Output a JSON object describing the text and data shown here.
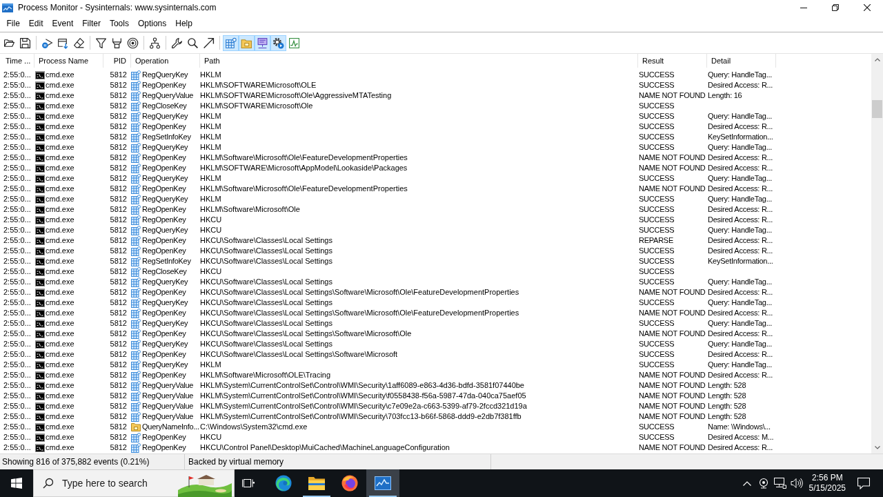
{
  "window": {
    "title": "Process Monitor - Sysinternals: www.sysinternals.com"
  },
  "menu": [
    "File",
    "Edit",
    "Event",
    "Filter",
    "Tools",
    "Options",
    "Help"
  ],
  "toolbar": {
    "event_class_toggles": [
      {
        "kind": "registry",
        "selected": true
      },
      {
        "kind": "file-system",
        "selected": true
      },
      {
        "kind": "network",
        "selected": true
      },
      {
        "kind": "process",
        "selected": true
      },
      {
        "kind": "profiling",
        "selected": false
      }
    ]
  },
  "table": {
    "columns": [
      "Time ...",
      "Process Name",
      "PID",
      "Operation",
      "Path",
      "Result",
      "Detail"
    ],
    "rows": [
      {
        "time": "2:55:0...",
        "process": "cmd.exe",
        "pid": "5812",
        "kind": "registry",
        "operation": "RegQueryKey",
        "path": "HKLM",
        "result": "SUCCESS",
        "detail": "Query: HandleTag..."
      },
      {
        "time": "2:55:0...",
        "process": "cmd.exe",
        "pid": "5812",
        "kind": "registry",
        "operation": "RegOpenKey",
        "path": "HKLM\\SOFTWARE\\Microsoft\\OLE",
        "result": "SUCCESS",
        "detail": "Desired Access: R..."
      },
      {
        "time": "2:55:0...",
        "process": "cmd.exe",
        "pid": "5812",
        "kind": "registry",
        "operation": "RegQueryValue",
        "path": "HKLM\\SOFTWARE\\Microsoft\\Ole\\AggressiveMTATesting",
        "result": "NAME NOT FOUND",
        "detail": "Length: 16"
      },
      {
        "time": "2:55:0...",
        "process": "cmd.exe",
        "pid": "5812",
        "kind": "registry",
        "operation": "RegCloseKey",
        "path": "HKLM\\SOFTWARE\\Microsoft\\Ole",
        "result": "SUCCESS"
      },
      {
        "time": "2:55:0...",
        "process": "cmd.exe",
        "pid": "5812",
        "kind": "registry",
        "operation": "RegQueryKey",
        "path": "HKLM",
        "result": "SUCCESS",
        "detail": "Query: HandleTag..."
      },
      {
        "time": "2:55:0...",
        "process": "cmd.exe",
        "pid": "5812",
        "kind": "registry",
        "operation": "RegOpenKey",
        "path": "HKLM",
        "result": "SUCCESS",
        "detail": "Desired Access: R..."
      },
      {
        "time": "2:55:0...",
        "process": "cmd.exe",
        "pid": "5812",
        "kind": "registry",
        "operation": "RegSetInfoKey",
        "path": "HKLM",
        "result": "SUCCESS",
        "detail": "KeySetInformation..."
      },
      {
        "time": "2:55:0...",
        "process": "cmd.exe",
        "pid": "5812",
        "kind": "registry",
        "operation": "RegQueryKey",
        "path": "HKLM",
        "result": "SUCCESS",
        "detail": "Query: HandleTag..."
      },
      {
        "time": "2:55:0...",
        "process": "cmd.exe",
        "pid": "5812",
        "kind": "registry",
        "operation": "RegOpenKey",
        "path": "HKLM\\Software\\Microsoft\\Ole\\FeatureDevelopmentProperties",
        "result": "NAME NOT FOUND",
        "detail": "Desired Access: R..."
      },
      {
        "time": "2:55:0...",
        "process": "cmd.exe",
        "pid": "5812",
        "kind": "registry",
        "operation": "RegOpenKey",
        "path": "HKLM\\SOFTWARE\\Microsoft\\AppModel\\Lookaside\\Packages",
        "result": "NAME NOT FOUND",
        "detail": "Desired Access: R..."
      },
      {
        "time": "2:55:0...",
        "process": "cmd.exe",
        "pid": "5812",
        "kind": "registry",
        "operation": "RegQueryKey",
        "path": "HKLM",
        "result": "SUCCESS",
        "detail": "Query: HandleTag..."
      },
      {
        "time": "2:55:0...",
        "process": "cmd.exe",
        "pid": "5812",
        "kind": "registry",
        "operation": "RegOpenKey",
        "path": "HKLM\\Software\\Microsoft\\Ole\\FeatureDevelopmentProperties",
        "result": "NAME NOT FOUND",
        "detail": "Desired Access: R..."
      },
      {
        "time": "2:55:0...",
        "process": "cmd.exe",
        "pid": "5812",
        "kind": "registry",
        "operation": "RegQueryKey",
        "path": "HKLM",
        "result": "SUCCESS",
        "detail": "Query: HandleTag..."
      },
      {
        "time": "2:55:0...",
        "process": "cmd.exe",
        "pid": "5812",
        "kind": "registry",
        "operation": "RegOpenKey",
        "path": "HKLM\\Software\\Microsoft\\Ole",
        "result": "SUCCESS",
        "detail": "Desired Access: R..."
      },
      {
        "time": "2:55:0...",
        "process": "cmd.exe",
        "pid": "5812",
        "kind": "registry",
        "operation": "RegOpenKey",
        "path": "HKCU",
        "result": "SUCCESS",
        "detail": "Desired Access: R..."
      },
      {
        "time": "2:55:0...",
        "process": "cmd.exe",
        "pid": "5812",
        "kind": "registry",
        "operation": "RegQueryKey",
        "path": "HKCU",
        "result": "SUCCESS",
        "detail": "Query: HandleTag..."
      },
      {
        "time": "2:55:0...",
        "process": "cmd.exe",
        "pid": "5812",
        "kind": "registry",
        "operation": "RegOpenKey",
        "path": "HKCU\\Software\\Classes\\Local Settings",
        "result": "REPARSE",
        "detail": "Desired Access: R..."
      },
      {
        "time": "2:55:0...",
        "process": "cmd.exe",
        "pid": "5812",
        "kind": "registry",
        "operation": "RegOpenKey",
        "path": "HKCU\\Software\\Classes\\Local Settings",
        "result": "SUCCESS",
        "detail": "Desired Access: R..."
      },
      {
        "time": "2:55:0...",
        "process": "cmd.exe",
        "pid": "5812",
        "kind": "registry",
        "operation": "RegSetInfoKey",
        "path": "HKCU\\Software\\Classes\\Local Settings",
        "result": "SUCCESS",
        "detail": "KeySetInformation..."
      },
      {
        "time": "2:55:0...",
        "process": "cmd.exe",
        "pid": "5812",
        "kind": "registry",
        "operation": "RegCloseKey",
        "path": "HKCU",
        "result": "SUCCESS"
      },
      {
        "time": "2:55:0...",
        "process": "cmd.exe",
        "pid": "5812",
        "kind": "registry",
        "operation": "RegQueryKey",
        "path": "HKCU\\Software\\Classes\\Local Settings",
        "result": "SUCCESS",
        "detail": "Query: HandleTag..."
      },
      {
        "time": "2:55:0...",
        "process": "cmd.exe",
        "pid": "5812",
        "kind": "registry",
        "operation": "RegOpenKey",
        "path": "HKCU\\Software\\Classes\\Local Settings\\Software\\Microsoft\\Ole\\FeatureDevelopmentProperties",
        "result": "NAME NOT FOUND",
        "detail": "Desired Access: R..."
      },
      {
        "time": "2:55:0...",
        "process": "cmd.exe",
        "pid": "5812",
        "kind": "registry",
        "operation": "RegQueryKey",
        "path": "HKCU\\Software\\Classes\\Local Settings",
        "result": "SUCCESS",
        "detail": "Query: HandleTag..."
      },
      {
        "time": "2:55:0...",
        "process": "cmd.exe",
        "pid": "5812",
        "kind": "registry",
        "operation": "RegOpenKey",
        "path": "HKCU\\Software\\Classes\\Local Settings\\Software\\Microsoft\\Ole\\FeatureDevelopmentProperties",
        "result": "NAME NOT FOUND",
        "detail": "Desired Access: R..."
      },
      {
        "time": "2:55:0...",
        "process": "cmd.exe",
        "pid": "5812",
        "kind": "registry",
        "operation": "RegQueryKey",
        "path": "HKCU\\Software\\Classes\\Local Settings",
        "result": "SUCCESS",
        "detail": "Query: HandleTag..."
      },
      {
        "time": "2:55:0...",
        "process": "cmd.exe",
        "pid": "5812",
        "kind": "registry",
        "operation": "RegOpenKey",
        "path": "HKCU\\Software\\Classes\\Local Settings\\Software\\Microsoft\\Ole",
        "result": "NAME NOT FOUND",
        "detail": "Desired Access: R..."
      },
      {
        "time": "2:55:0...",
        "process": "cmd.exe",
        "pid": "5812",
        "kind": "registry",
        "operation": "RegQueryKey",
        "path": "HKCU\\Software\\Classes\\Local Settings",
        "result": "SUCCESS",
        "detail": "Query: HandleTag..."
      },
      {
        "time": "2:55:0...",
        "process": "cmd.exe",
        "pid": "5812",
        "kind": "registry",
        "operation": "RegOpenKey",
        "path": "HKCU\\Software\\Classes\\Local Settings\\Software\\Microsoft",
        "result": "SUCCESS",
        "detail": "Desired Access: R..."
      },
      {
        "time": "2:55:0...",
        "process": "cmd.exe",
        "pid": "5812",
        "kind": "registry",
        "operation": "RegQueryKey",
        "path": "HKLM",
        "result": "SUCCESS",
        "detail": "Query: HandleTag..."
      },
      {
        "time": "2:55:0...",
        "process": "cmd.exe",
        "pid": "5812",
        "kind": "registry",
        "operation": "RegOpenKey",
        "path": "HKLM\\Software\\Microsoft\\OLE\\Tracing",
        "result": "NAME NOT FOUND",
        "detail": "Desired Access: R..."
      },
      {
        "time": "2:55:0...",
        "process": "cmd.exe",
        "pid": "5812",
        "kind": "registry",
        "operation": "RegQueryValue",
        "path": "HKLM\\System\\CurrentControlSet\\Control\\WMI\\Security\\1aff6089-e863-4d36-bdfd-3581f07440be",
        "result": "NAME NOT FOUND",
        "detail": "Length: 528"
      },
      {
        "time": "2:55:0...",
        "process": "cmd.exe",
        "pid": "5812",
        "kind": "registry",
        "operation": "RegQueryValue",
        "path": "HKLM\\System\\CurrentControlSet\\Control\\WMI\\Security\\f0558438-f56a-5987-47da-040ca75aef05",
        "result": "NAME NOT FOUND",
        "detail": "Length: 528"
      },
      {
        "time": "2:55:0...",
        "process": "cmd.exe",
        "pid": "5812",
        "kind": "registry",
        "operation": "RegQueryValue",
        "path": "HKLM\\System\\CurrentControlSet\\Control\\WMI\\Security\\c7e09e2a-c663-5399-af79-2fccd321d19a",
        "result": "NAME NOT FOUND",
        "detail": "Length: 528"
      },
      {
        "time": "2:55:0...",
        "process": "cmd.exe",
        "pid": "5812",
        "kind": "registry",
        "operation": "RegQueryValue",
        "path": "HKLM\\System\\CurrentControlSet\\Control\\WMI\\Security\\703fcc13-b66f-5868-ddd9-e2db7f381ffb",
        "result": "NAME NOT FOUND",
        "detail": "Length: 528"
      },
      {
        "time": "2:55:0...",
        "process": "cmd.exe",
        "pid": "5812",
        "kind": "file",
        "operation": "QueryNameInfo...",
        "path": "C:\\Windows\\System32\\cmd.exe",
        "result": "SUCCESS",
        "detail": "Name: \\Windows\\..."
      },
      {
        "time": "2:55:0...",
        "process": "cmd.exe",
        "pid": "5812",
        "kind": "registry",
        "operation": "RegOpenKey",
        "path": "HKCU",
        "result": "SUCCESS",
        "detail": "Desired Access: M..."
      },
      {
        "time": "2:55:0...",
        "process": "cmd.exe",
        "pid": "5812",
        "kind": "registry",
        "operation": "RegOpenKey",
        "path": "HKCU\\Control Panel\\Desktop\\MuiCached\\MachineLanguageConfiguration",
        "result": "NAME NOT FOUND",
        "detail": "Desired Access: R..."
      }
    ]
  },
  "status_bar": [
    "Showing 816 of 375,882 events (0.21%)",
    "Backed by virtual memory"
  ],
  "taskbar": {
    "search": {
      "placeholder": "Type here to search"
    },
    "apps": [
      {
        "kind": "swirl",
        "running": false,
        "selected": false
      },
      {
        "kind": "folder",
        "running": true,
        "selected": false
      },
      {
        "kind": "fox",
        "running": false,
        "selected": false
      },
      {
        "kind": "monitor",
        "running": true,
        "selected": true
      }
    ],
    "time": "2:56 PM",
    "date": "5/15/2025"
  }
}
